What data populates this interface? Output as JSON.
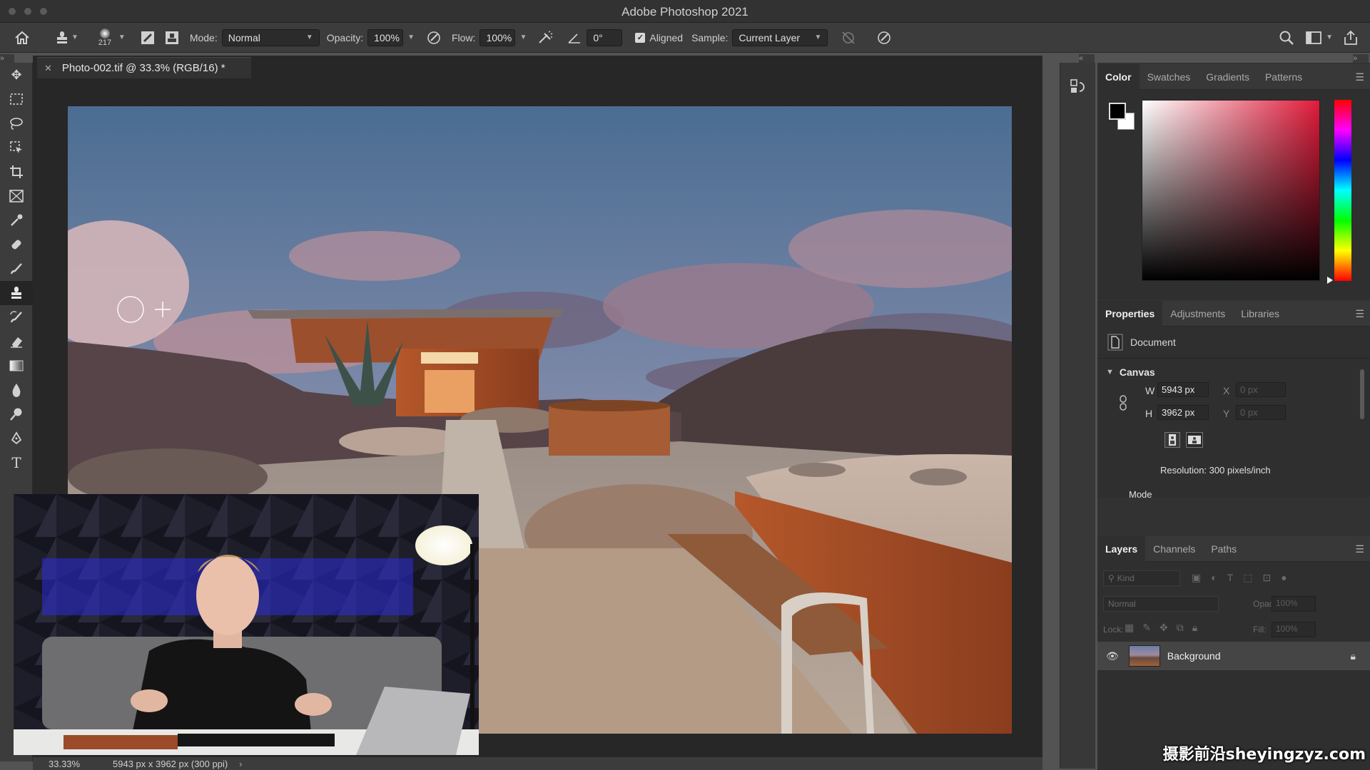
{
  "window": {
    "title": "Adobe Photoshop 2021"
  },
  "options_bar": {
    "brush_size": "217",
    "mode_label": "Mode:",
    "mode_value": "Normal",
    "opacity_label": "Opacity:",
    "opacity_value": "100%",
    "flow_label": "Flow:",
    "flow_value": "100%",
    "angle_value": "0°",
    "aligned_label": "Aligned",
    "aligned_checked": true,
    "sample_label": "Sample:",
    "sample_value": "Current Layer"
  },
  "document": {
    "tab_title": "Photo-002.tif @ 33.3% (RGB/16) *"
  },
  "status_bar": {
    "zoom": "33.33%",
    "info": "5943 px x 3962 px (300 ppi)"
  },
  "color_panel": {
    "tabs": [
      "Color",
      "Swatches",
      "Gradients",
      "Patterns"
    ],
    "active_tab": "Color",
    "foreground": "#000000",
    "background": "#ffffff",
    "hue_color": "#e01b3a"
  },
  "properties_panel": {
    "tabs": [
      "Properties",
      "Adjustments",
      "Libraries"
    ],
    "active_tab": "Properties",
    "document_label": "Document",
    "canvas_label": "Canvas",
    "w_label": "W",
    "w_value": "5943 px",
    "h_label": "H",
    "h_value": "3962 px",
    "x_label": "X",
    "x_value": "0 px",
    "y_label": "Y",
    "y_value": "0 px",
    "resolution": "Resolution: 300 pixels/inch",
    "mode_label": "Mode"
  },
  "layers_panel": {
    "tabs": [
      "Layers",
      "Channels",
      "Paths"
    ],
    "active_tab": "Layers",
    "kind_placeholder": "Kind",
    "blend_mode": "Normal",
    "opacity_label": "Opacity:",
    "opacity_value": "100%",
    "lock_label": "Lock:",
    "fill_label": "Fill:",
    "fill_value": "100%",
    "layers": [
      {
        "name": "Background",
        "visible": true,
        "locked": true
      }
    ]
  },
  "watermark": "摄影前沿sheyingzyz.com"
}
